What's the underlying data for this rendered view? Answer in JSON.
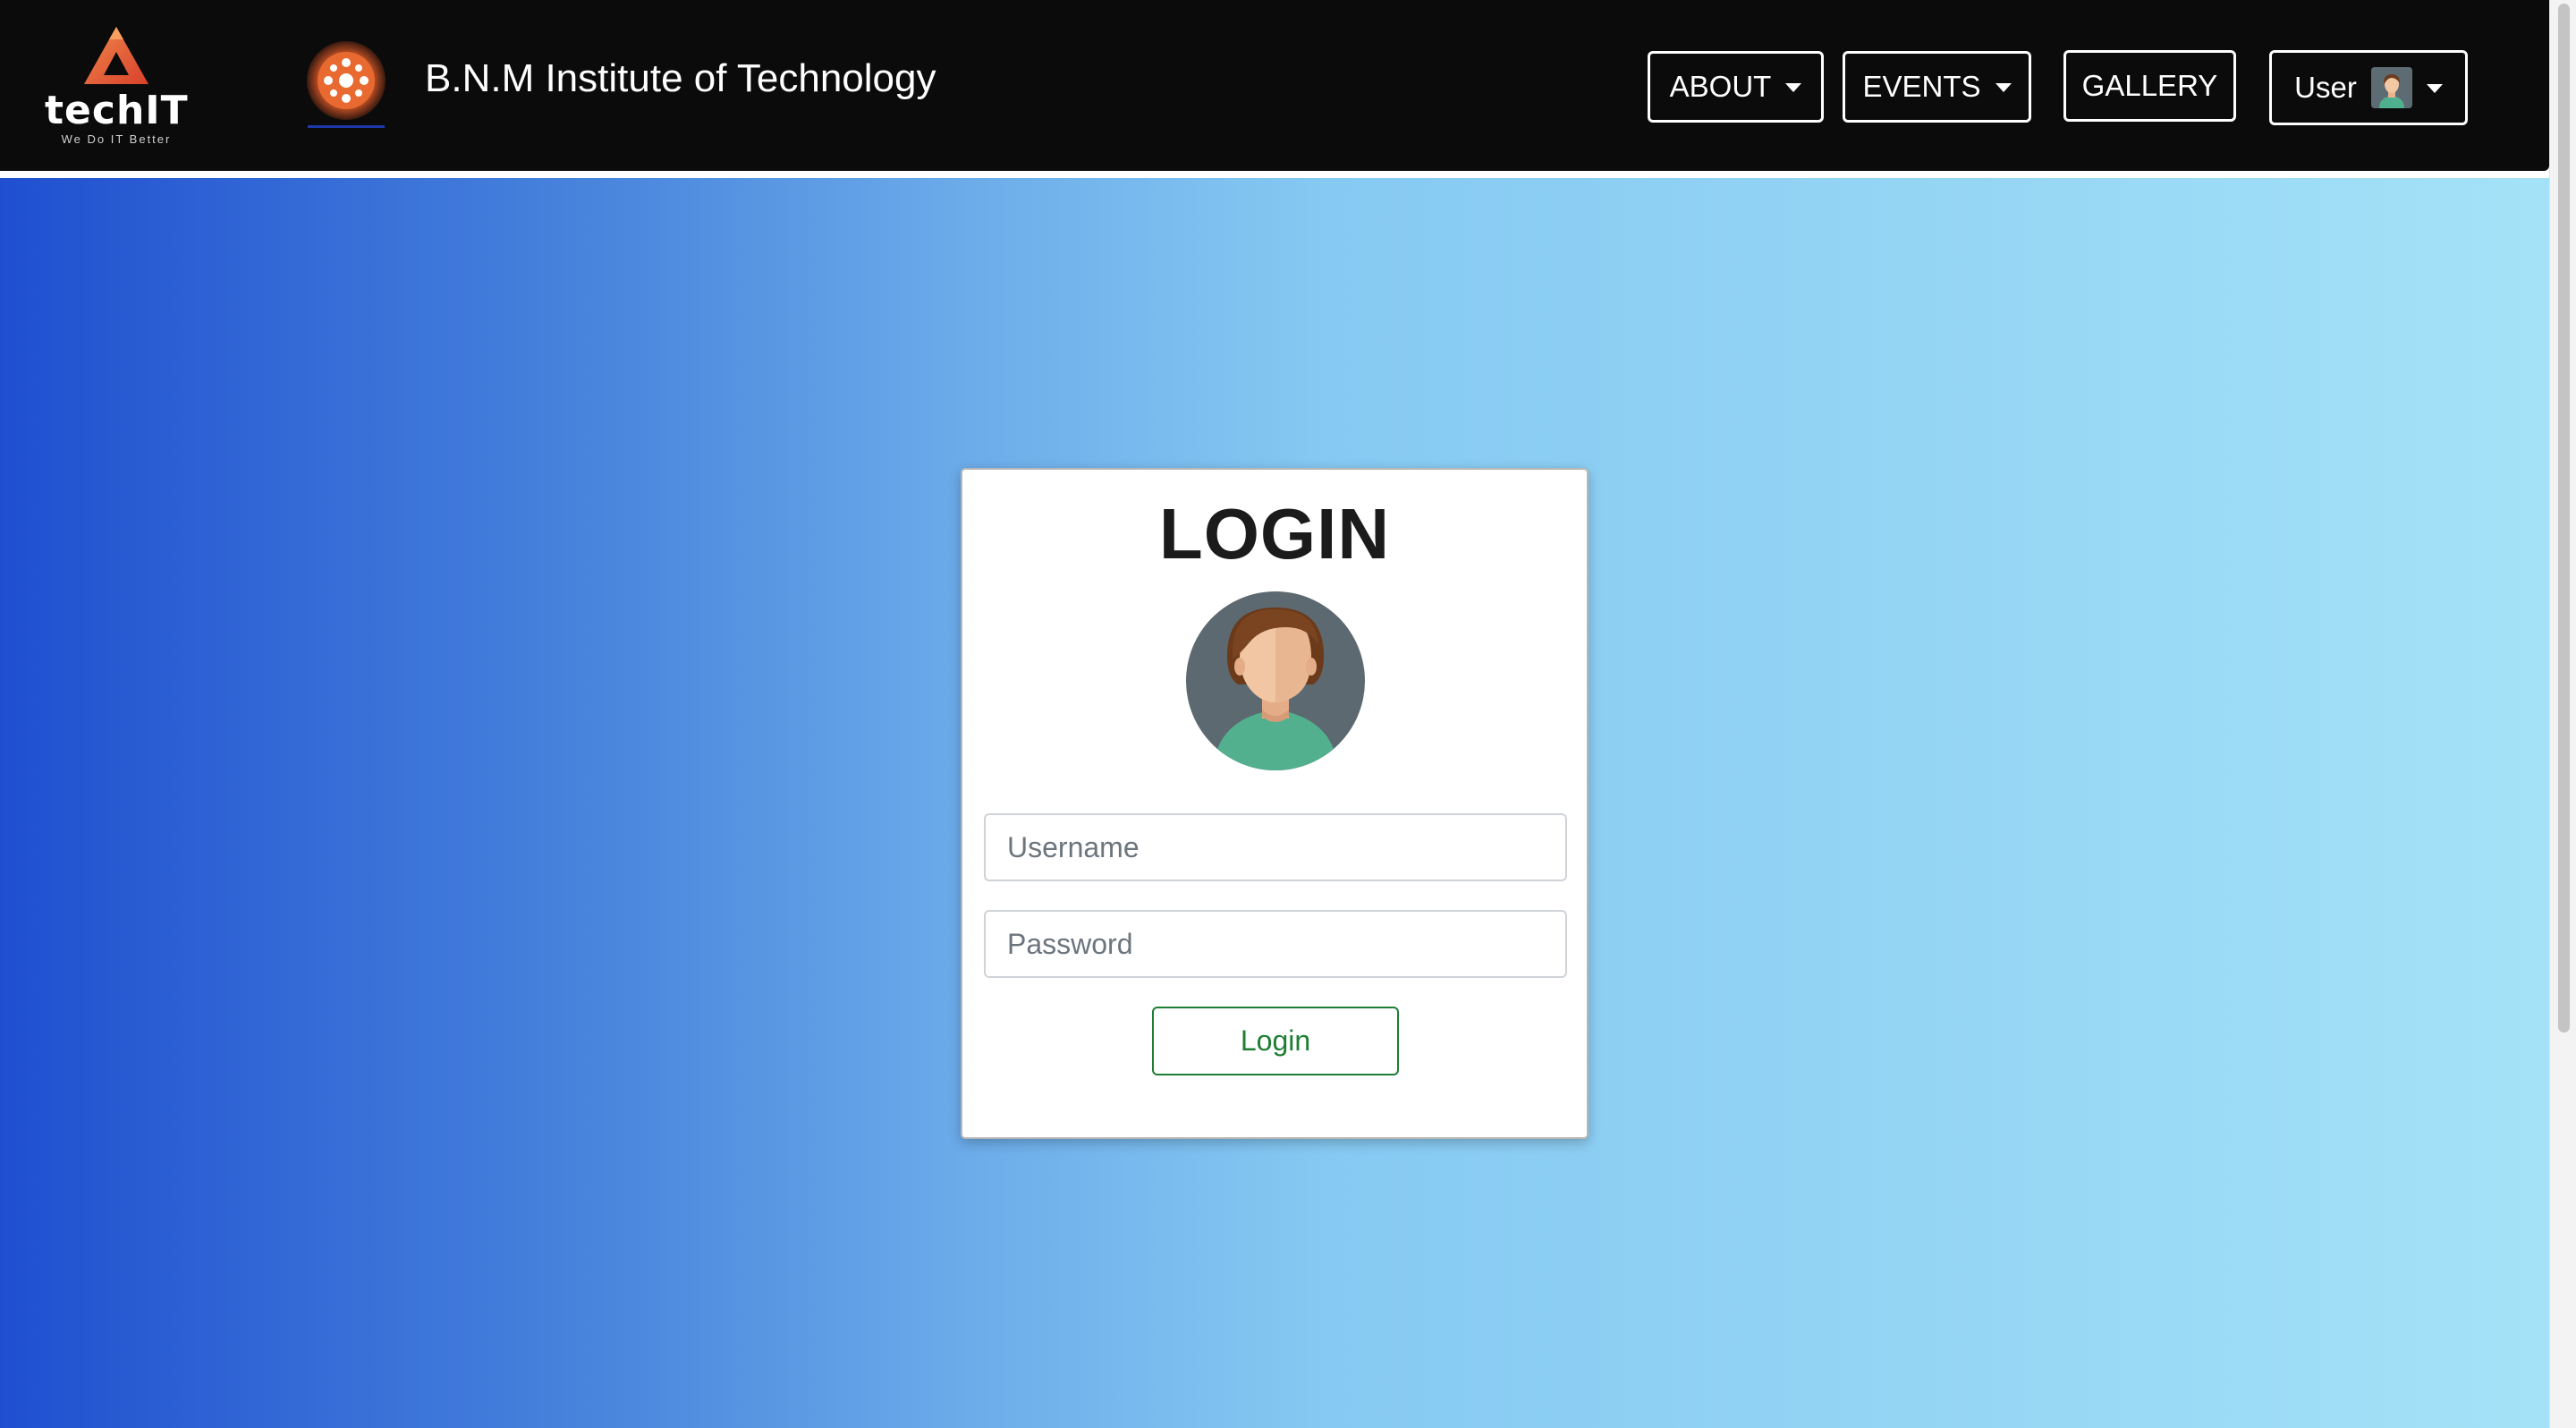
{
  "header": {
    "brand_name": "techIT",
    "brand_tagline": "We Do IT Better",
    "college_title": "B.N.M Institute of Technology",
    "nav": {
      "about_label": "ABOUT",
      "events_label": "EVENTS",
      "gallery_label": "GALLERY",
      "user_label": "User"
    }
  },
  "login": {
    "title": "LOGIN",
    "username_placeholder": "Username",
    "password_placeholder": "Password",
    "button_label": "Login"
  },
  "colors": {
    "navbar_bg": "#0b0b0b",
    "gradient_start": "#1f4fd0",
    "gradient_end": "#a4e2f7",
    "login_button": "#1e7e34",
    "brand_accent": "#e8553a"
  },
  "icons": {
    "brand": "techit-triangle-logo",
    "college": "bnmit-emblem",
    "user": "user-avatar",
    "profile": "profile-avatar"
  }
}
